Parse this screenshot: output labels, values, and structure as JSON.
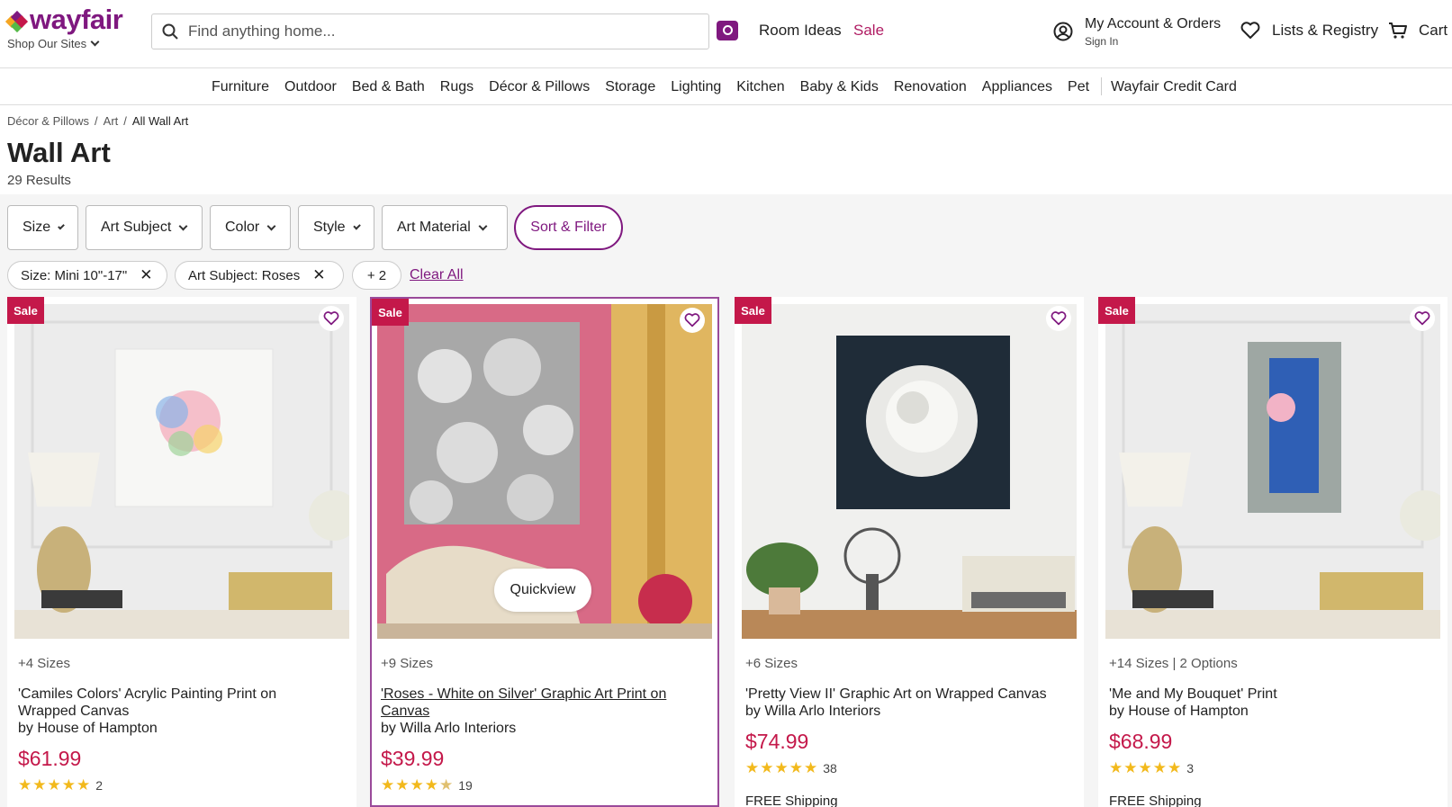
{
  "header": {
    "logo_text": "wayfair",
    "shop_sites": "Shop Our Sites",
    "search_placeholder": "Find anything home...",
    "room_ideas": "Room Ideas",
    "sale": "Sale",
    "account_title": "My Account & Orders",
    "account_sub": "Sign In",
    "lists": "Lists & Registry",
    "cart": "Cart",
    "brand_color": "#7F187F",
    "sale_color": "#B01C63"
  },
  "nav": {
    "items": [
      "Furniture",
      "Outdoor",
      "Bed & Bath",
      "Rugs",
      "Décor & Pillows",
      "Storage",
      "Lighting",
      "Kitchen",
      "Baby & Kids",
      "Renovation",
      "Appliances",
      "Pet"
    ],
    "credit_card": "Wayfair Credit Card"
  },
  "breadcrumb": {
    "items": [
      "Décor & Pillows",
      "Art",
      "All Wall Art"
    ]
  },
  "page": {
    "title": "Wall Art",
    "results": "29 Results"
  },
  "filters": {
    "buttons": [
      "Size",
      "Art Subject",
      "Color",
      "Style",
      "Art Material"
    ],
    "sort_filter": "Sort & Filter",
    "chips": [
      "Size: Mini 10\"-17\"",
      "Art Subject: Roses"
    ],
    "more": "+ 2",
    "clear_all": "Clear All"
  },
  "products": [
    {
      "badge": "Sale",
      "sizes": "+4 Sizes",
      "title": "'Camiles Colors' Acrylic Painting Print on Wrapped Canvas",
      "brand": "by House of Hampton",
      "price": "$61.99",
      "rating": 5,
      "reviews": "2"
    },
    {
      "badge": "Sale",
      "sizes": "+9 Sizes",
      "title": "'Roses - White on Silver' Graphic Art Print on Canvas",
      "brand": "by Willa Arlo Interiors",
      "price": "$39.99",
      "rating": 4.5,
      "reviews": "19",
      "quickview": "Quickview"
    },
    {
      "badge": "Sale",
      "sizes": "+6 Sizes",
      "title": "'Pretty View II' Graphic Art on Wrapped Canvas",
      "brand": "by Willa Arlo Interiors",
      "price": "$74.99",
      "rating": 5,
      "reviews": "38",
      "shipping": "FREE Shipping"
    },
    {
      "badge": "Sale",
      "sizes": "+14 Sizes | 2 Options",
      "title": "'Me and My Bouquet' Print",
      "brand": "by House of Hampton",
      "price": "$68.99",
      "rating": 5,
      "reviews": "3",
      "shipping": "FREE Shipping"
    }
  ]
}
